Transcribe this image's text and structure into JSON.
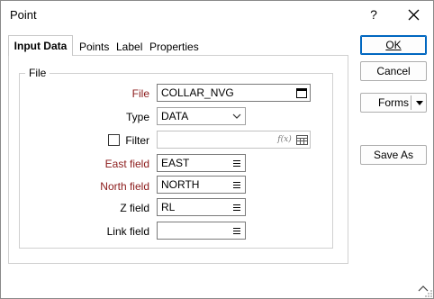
{
  "window": {
    "title": "Point",
    "help": "?"
  },
  "tabs": [
    {
      "label": "Input Data",
      "active": true
    },
    {
      "label": "Points",
      "active": false
    },
    {
      "label": "Label",
      "active": false
    },
    {
      "label": "Properties",
      "active": false
    }
  ],
  "file_group": {
    "legend": "File",
    "file_label": "File",
    "file_value": "COLLAR_NVG",
    "type_label": "Type",
    "type_value": "DATA",
    "filter_label": "Filter",
    "filter_checked": false,
    "filter_value": "",
    "filter_icon_text": "f(x)",
    "east_label": "East field",
    "east_value": "EAST",
    "north_label": "North field",
    "north_value": "NORTH",
    "z_label": "Z field",
    "z_value": "RL",
    "link_label": "Link field",
    "link_value": ""
  },
  "buttons": {
    "ok": "OK",
    "cancel": "Cancel",
    "forms": "Forms",
    "save_as": "Save As"
  },
  "colors": {
    "required_label": "#8b1a1a",
    "default_button_border": "#0067c0"
  }
}
